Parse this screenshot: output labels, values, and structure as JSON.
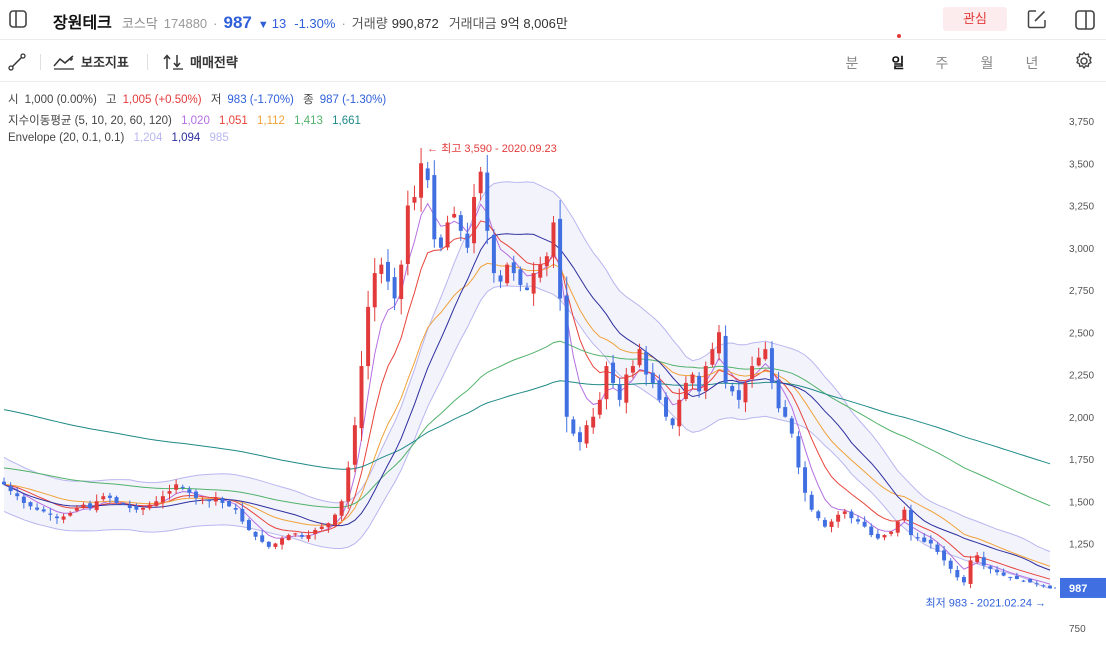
{
  "header": {
    "name": "장원테크",
    "market": "코스닥",
    "code": "174880",
    "dot": "·",
    "price": "987",
    "change_arrow": "▼",
    "change": "13",
    "change_pct": "-1.30%",
    "volume_label": "거래량",
    "volume": "990,872",
    "amount_label": "거래대금",
    "amount": "9억 8,006만",
    "watch_label": "관심"
  },
  "toolbar": {
    "indicator_label": "보조지표",
    "strategy_label": "매매전략",
    "periods": [
      "분",
      "일",
      "주",
      "월",
      "년"
    ],
    "active_period": "일"
  },
  "ohlc_legend": {
    "open_label": "시",
    "open": "1,000 (0.00%)",
    "high_label": "고",
    "high": "1,005 (+0.50%)",
    "low_label": "저",
    "low": "983 (-1.70%)",
    "close_label": "종",
    "close": "987 (-1.30%)"
  },
  "ema_legend": {
    "label": "지수이동평균 (5, 10, 20, 60, 120)",
    "values": [
      "1,020",
      "1,051",
      "1,112",
      "1,413",
      "1,661"
    ],
    "colors": [
      "#b56fe0",
      "#e8433a",
      "#f0a23a",
      "#52b26a",
      "#1f8a86"
    ]
  },
  "env_legend": {
    "label": "Envelope (20, 0.1, 0.1)",
    "values": [
      "1,204",
      "1,094",
      "985"
    ],
    "colors": [
      "#b9b6ef",
      "#2e2e9e",
      "#b9b6ef"
    ]
  },
  "chart_data": {
    "type": "candlestick",
    "ylim": [
      650,
      3900
    ],
    "yticks": [
      750,
      1250,
      1500,
      1750,
      2000,
      2250,
      2500,
      2750,
      3000,
      3250,
      3500,
      3750
    ],
    "ytick_labels": [
      "750",
      "1,250",
      "1,500",
      "1,750",
      "2,000",
      "2,250",
      "2,500",
      "2,750",
      "3,000",
      "3,250",
      "3,500",
      "3,750"
    ],
    "current_price": 987,
    "current_price_label": "987",
    "high_annotation": {
      "value": 3590,
      "text": "최고 3,590 - 2020.09.23"
    },
    "low_annotation": {
      "value": 983,
      "text": "최저 983 - 2021.02.24"
    },
    "closes": [
      1600,
      1560,
      1530,
      1490,
      1470,
      1450,
      1440,
      1420,
      1400,
      1410,
      1430,
      1460,
      1480,
      1460,
      1500,
      1530,
      1520,
      1490,
      1480,
      1460,
      1450,
      1460,
      1480,
      1500,
      1530,
      1560,
      1600,
      1580,
      1550,
      1520,
      1510,
      1500,
      1520,
      1490,
      1470,
      1450,
      1380,
      1330,
      1290,
      1260,
      1230,
      1250,
      1280,
      1300,
      1310,
      1290,
      1300,
      1330,
      1350,
      1370,
      1420,
      1500,
      1700,
      1950,
      2300,
      2650,
      2850,
      2900,
      2800,
      2700,
      2900,
      3250,
      3300,
      3500,
      3400,
      3050,
      3000,
      3150,
      3200,
      3100,
      3000,
      3300,
      3450,
      3100,
      2850,
      2800,
      2900,
      2850,
      2780,
      2750,
      2850,
      2900,
      2950,
      3150,
      2700,
      2000,
      1900,
      1850,
      1950,
      2000,
      2100,
      2300,
      2200,
      2100,
      2250,
      2300,
      2400,
      2250,
      2200,
      2100,
      2000,
      1950,
      2100,
      2200,
      2250,
      2150,
      2300,
      2400,
      2500,
      2200,
      2150,
      2100,
      2200,
      2300,
      2350,
      2400,
      2200,
      2050,
      2000,
      1900,
      1700,
      1550,
      1450,
      1400,
      1350,
      1380,
      1420,
      1440,
      1400,
      1380,
      1350,
      1300,
      1280,
      1300,
      1320,
      1380,
      1450,
      1300,
      1280,
      1260,
      1250,
      1200,
      1150,
      1100,
      1050,
      1020,
      1150,
      1180,
      1120,
      1100,
      1080,
      1060,
      1050,
      1040,
      1030,
      1020,
      1010,
      1000,
      987
    ],
    "ema_series": [
      {
        "name": "EMA 5",
        "color": "#b56fe0"
      },
      {
        "name": "EMA 10",
        "color": "#e8433a"
      },
      {
        "name": "EMA 20",
        "color": "#f0a23a"
      },
      {
        "name": "EMA 60",
        "color": "#52b26a"
      },
      {
        "name": "EMA 120",
        "color": "#1f8a86"
      }
    ],
    "envelope": {
      "period": 20,
      "pct": 0.1,
      "upper_color": "#b9b6ef",
      "mid_color": "#2e2e9e"
    },
    "colors": {
      "up": "#e23a3a",
      "down": "#3f6fe0"
    }
  }
}
